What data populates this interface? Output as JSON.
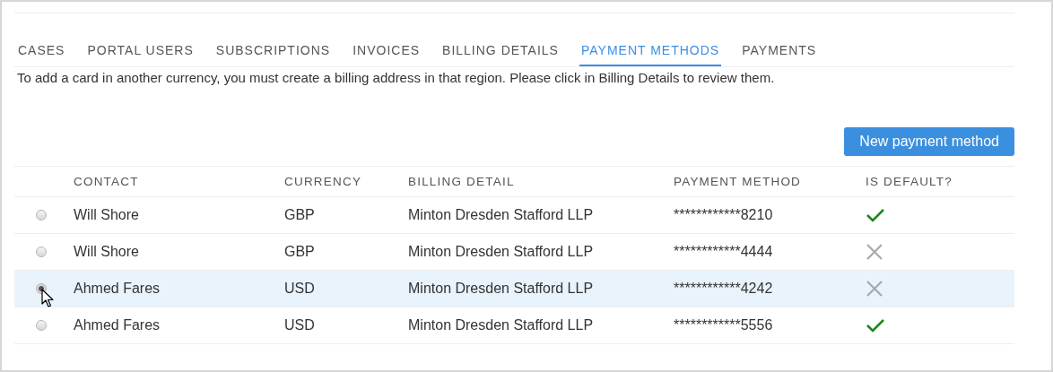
{
  "tabs": [
    {
      "label": "CASES",
      "selected": false
    },
    {
      "label": "PORTAL USERS",
      "selected": false
    },
    {
      "label": "SUBSCRIPTIONS",
      "selected": false
    },
    {
      "label": "INVOICES",
      "selected": false
    },
    {
      "label": "BILLING DETAILS",
      "selected": false
    },
    {
      "label": "PAYMENT METHODS",
      "selected": true
    },
    {
      "label": "PAYMENTS",
      "selected": false
    }
  ],
  "notice": "To add a card in another currency, you must create a billing address in that region. Please click in Billing Details to review them.",
  "new_button": "New payment method",
  "table": {
    "columns": [
      "CONTACT",
      "CURRENCY",
      "BILLING DETAIL",
      "PAYMENT METHOD",
      "IS DEFAULT?"
    ],
    "rows": [
      {
        "selected": false,
        "contact": "Will Shore",
        "currency": "GBP",
        "billing_detail": "Minton Dresden Stafford LLP",
        "payment_method": "************8210",
        "is_default": true
      },
      {
        "selected": false,
        "contact": "Will Shore",
        "currency": "GBP",
        "billing_detail": "Minton Dresden Stafford LLP",
        "payment_method": "************4444",
        "is_default": false
      },
      {
        "selected": true,
        "contact": "Ahmed Fares",
        "currency": "USD",
        "billing_detail": "Minton Dresden Stafford LLP",
        "payment_method": "************4242",
        "is_default": false
      },
      {
        "selected": false,
        "contact": "Ahmed Fares",
        "currency": "USD",
        "billing_detail": "Minton Dresden Stafford LLP",
        "payment_method": "************5556",
        "is_default": true
      }
    ]
  }
}
